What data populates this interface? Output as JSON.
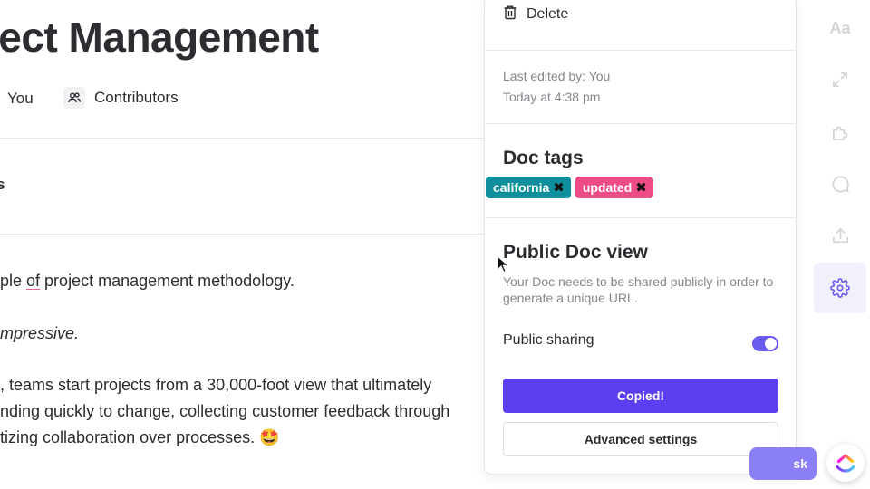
{
  "document": {
    "title_fragment": "ject Management",
    "owner_fragment": "You",
    "contributors_label": "Contributors",
    "section_fragment": "s",
    "paragraphs": {
      "p1_pre": "ple ",
      "p1_link": "of",
      "p1_post": " project management methodology.",
      "p2": "mpressive.",
      "p3": ", teams start projects from a 30,000-foot view that ultimately",
      "p4": "nding quickly to change, collecting customer feedback through",
      "p5": "tizing collaboration over processes. 🤩"
    }
  },
  "panel": {
    "delete_label": "Delete",
    "last_edited_by": "Last edited by: You",
    "last_edited_time": "Today at 4:38 pm",
    "doc_tags_title": "Doc tags",
    "tags": [
      {
        "label": "california",
        "color": "#0f8f9c"
      },
      {
        "label": "updated",
        "color": "#ee4c86"
      }
    ],
    "tag_remove_glyph": "✖",
    "public_view_title": "Public Doc view",
    "public_view_desc": "Your Doc needs to be shared publicly in order to generate a unique URL.",
    "public_sharing_label": "Public sharing",
    "public_sharing_enabled": true,
    "copy_button_label": "Copied!",
    "advanced_button_label": "Advanced settings"
  },
  "rail": {
    "font_button_label": "Aa",
    "items": [
      "font-icon",
      "expand-arrows-icon",
      "puzzle-icon",
      "comment-icon",
      "upload-icon",
      "gear-icon"
    ],
    "active_item": "gear-icon"
  },
  "floating": {
    "task_button_fragment": "sk"
  },
  "colors": {
    "accent": "#5b3ff0",
    "toggle_on": "#6a5af0",
    "tag_teal": "#0f8f9c",
    "tag_pink": "#ee4c86"
  }
}
